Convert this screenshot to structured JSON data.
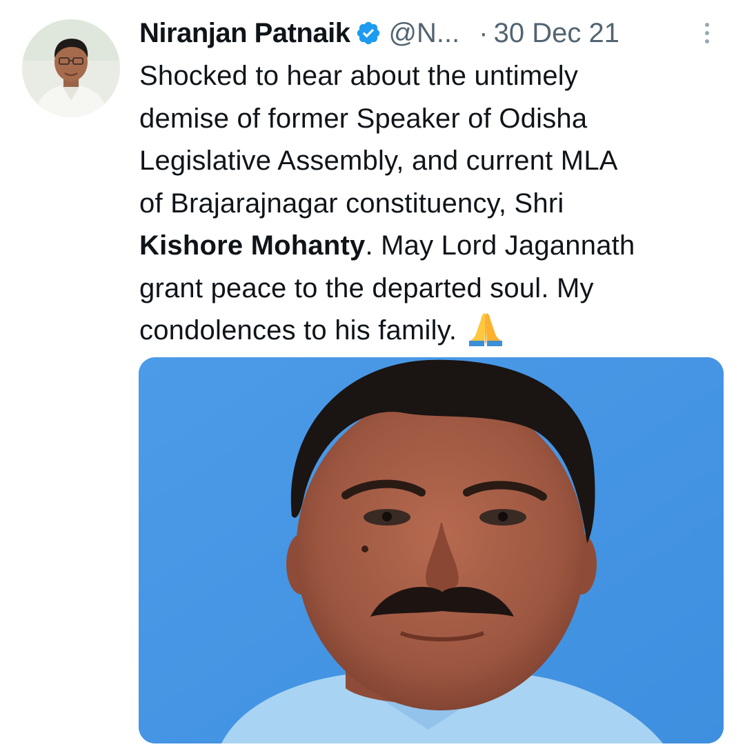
{
  "tweet": {
    "author": {
      "name": "Niranjan Patnaik",
      "handle": "@N...",
      "verified_icon": "verified-badge-icon",
      "avatar_alt": "profile photo"
    },
    "separator": "·",
    "date": "30 Dec 21",
    "more_icon": "more-vertical-icon",
    "text": {
      "line1": "Shocked to hear about the untimely",
      "line2": "demise of former Speaker of Odisha",
      "line3": "Legislative Assembly, and current MLA",
      "line4": "of Brajarajnagar constituency, Shri",
      "line5_bold": "Kishore Mohanty",
      "line5_rest": ". May Lord Jagannath",
      "line6": "grant peace to the departed soul. My",
      "line7": "condolences to his family.",
      "emoji": "folded-hands-emoji"
    },
    "media": {
      "type": "photo",
      "background_color": "#4a9ae6"
    }
  },
  "colors": {
    "text": "#0f1419",
    "secondary_text": "#536471",
    "verified_blue": "#1d9bf0",
    "photo_background": "#4a9ae6"
  }
}
